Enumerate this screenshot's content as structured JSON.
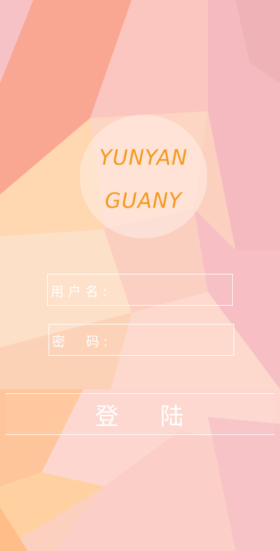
{
  "logo": {
    "line1": "YUNYAN",
    "line2": "GUANY"
  },
  "username": {
    "label": "用户名:",
    "value": ""
  },
  "password": {
    "label": "密  码:",
    "value": ""
  },
  "login_button": {
    "label": "登陆"
  },
  "colors": {
    "logo_text": "#f39a1e",
    "foreground": "#ffffff"
  }
}
